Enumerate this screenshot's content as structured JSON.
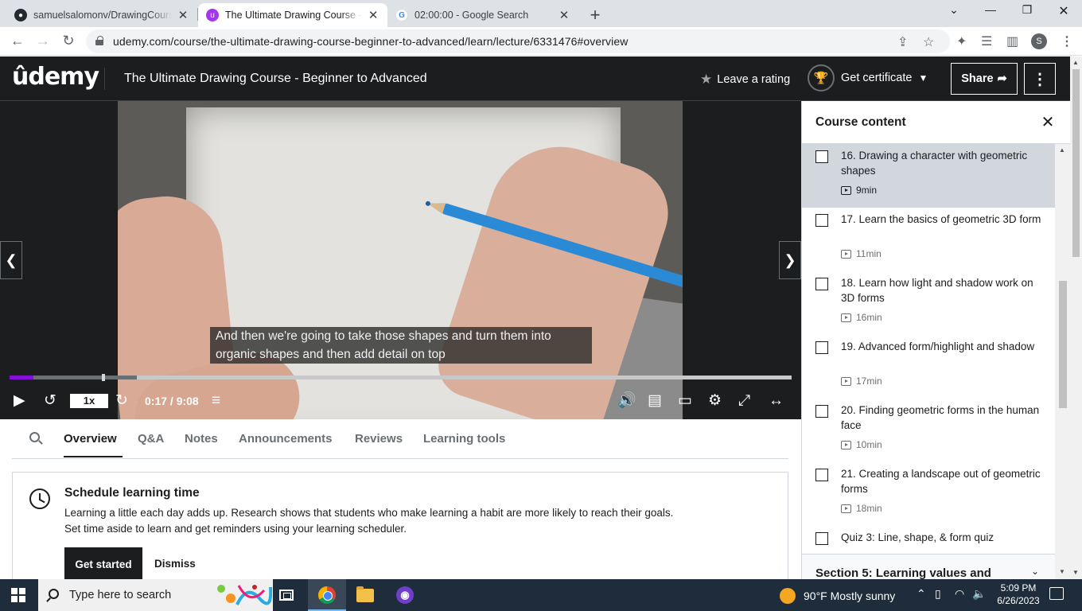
{
  "browser": {
    "tabs": [
      {
        "title": "samuelsalomonv/DrawingCourse",
        "icon": "github-icon"
      },
      {
        "title": "The Ultimate Drawing Course - B",
        "icon": "udemy-icon"
      },
      {
        "title": "02:00:00 - Google Search",
        "icon": "google-icon"
      }
    ],
    "new_tab": "+",
    "url": "udemy.com/course/the-ultimate-drawing-course-beginner-to-advanced/learn/lecture/6331476#overview",
    "profile_initial": "S"
  },
  "header": {
    "logo": "ûdemy",
    "course_title": "The Ultimate Drawing Course - Beginner to Advanced",
    "rating_label": "Leave a rating",
    "certificate_label": "Get certificate",
    "share_label": "Share"
  },
  "player": {
    "caption_line1": "And then we're going to take those shapes and turn them into",
    "caption_line2": "organic shapes and then add detail on top",
    "speed": "1x",
    "time": "0:17 / 9:08",
    "progress": 0.031
  },
  "lower_tabs": [
    "Overview",
    "Q&A",
    "Notes",
    "Announcements",
    "Reviews",
    "Learning tools"
  ],
  "schedule": {
    "title": "Schedule learning time",
    "line1": "Learning a little each day adds up. Research shows that students who make learning a habit are more likely to reach their goals.",
    "line2": "Set time aside to learn and get reminders using your learning scheduler.",
    "start_label": "Get started",
    "dismiss_label": "Dismiss"
  },
  "sidebar": {
    "title": "Course content",
    "lectures": [
      {
        "title": "16. Drawing a character with geometric shapes",
        "duration": "9min",
        "current": true
      },
      {
        "title": "17. Learn the basics of geometric 3D form",
        "duration": "11min"
      },
      {
        "title": "18. Learn how light and shadow work on 3D forms",
        "duration": "16min"
      },
      {
        "title": "19. Advanced form/highlight and shadow",
        "duration": "17min"
      },
      {
        "title": "20. Finding geometric forms in the human face",
        "duration": "10min"
      },
      {
        "title": "21. Creating a landscape out of geometric forms",
        "duration": "18min"
      },
      {
        "title": "Quiz 3: Line, shape, & form quiz",
        "duration": ""
      }
    ],
    "next_section": "Section 5: Learning values and"
  },
  "taskbar": {
    "search_placeholder": "Type here to search",
    "weather": "90°F  Mostly sunny",
    "time": "5:09 PM",
    "date": "6/26/2023"
  },
  "colors": {
    "udemy_dark": "#1c1d1f",
    "udemy_purple": "#8710d8",
    "taskbar": "#1f2c3b"
  }
}
